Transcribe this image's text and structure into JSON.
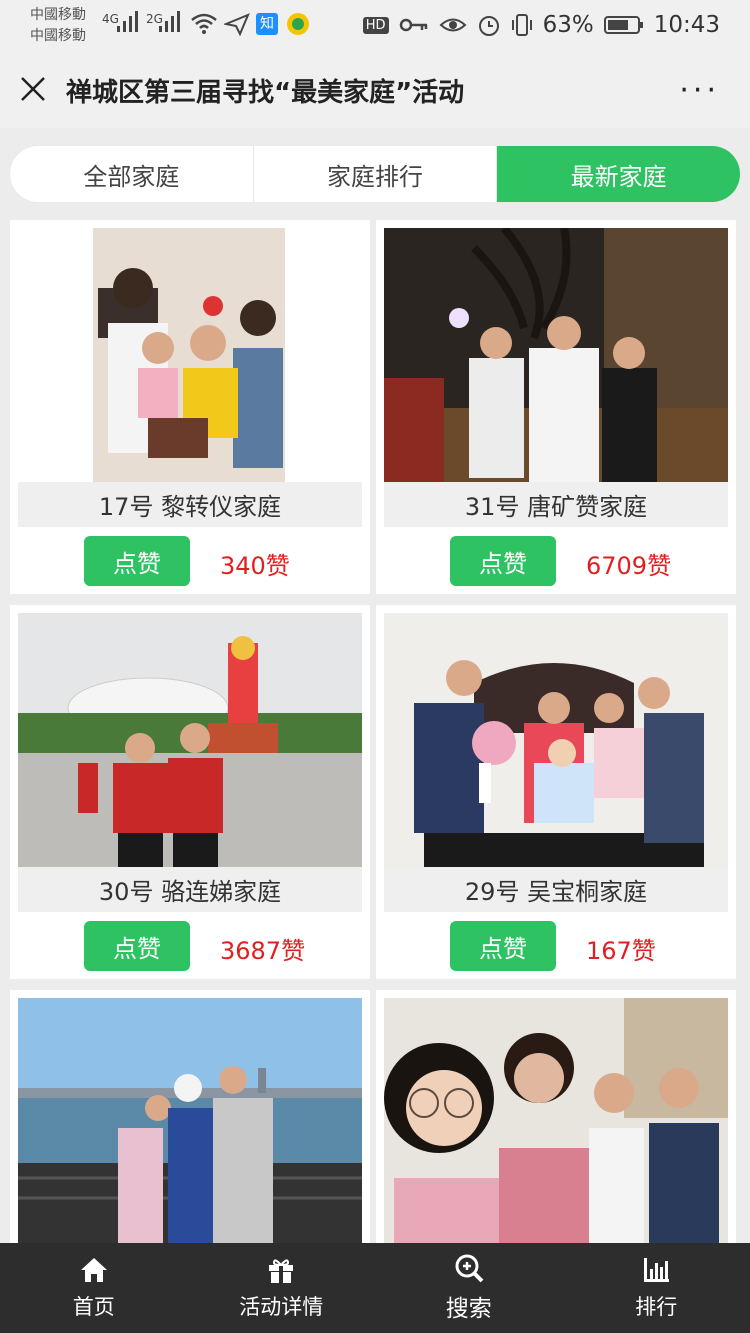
{
  "status_bar": {
    "carrier1": "中國移動",
    "carrier2": "中國移動",
    "net1": "4G",
    "net2": "2G",
    "app_badge": "知",
    "hd": "HD",
    "battery": "63%",
    "time": "10:43"
  },
  "header": {
    "title": "禅城区第三届寻找“最美家庭”活动",
    "more": "···"
  },
  "tabs": [
    {
      "label": "全部家庭",
      "active": false
    },
    {
      "label": "家庭排行",
      "active": false
    },
    {
      "label": "最新家庭",
      "active": true
    }
  ],
  "accent_color": "#2ec262",
  "like_count_color": "#e02020",
  "cards": [
    {
      "label": "17号 黎转仪家庭",
      "button": "点赞",
      "likes": "340赞"
    },
    {
      "label": "31号 唐矿赞家庭",
      "button": "点赞",
      "likes": "6709赞"
    },
    {
      "label": "30号 骆连娣家庭",
      "button": "点赞",
      "likes": "3687赞"
    },
    {
      "label": "29号 吴宝桐家庭",
      "button": "点赞",
      "likes": "167赞"
    }
  ],
  "bottom_nav": [
    {
      "label": "首页",
      "icon": "home-icon"
    },
    {
      "label": "活动详情",
      "icon": "gift-icon"
    },
    {
      "label": "搜索",
      "icon": "search-icon"
    },
    {
      "label": "排行",
      "icon": "chart-icon"
    }
  ]
}
